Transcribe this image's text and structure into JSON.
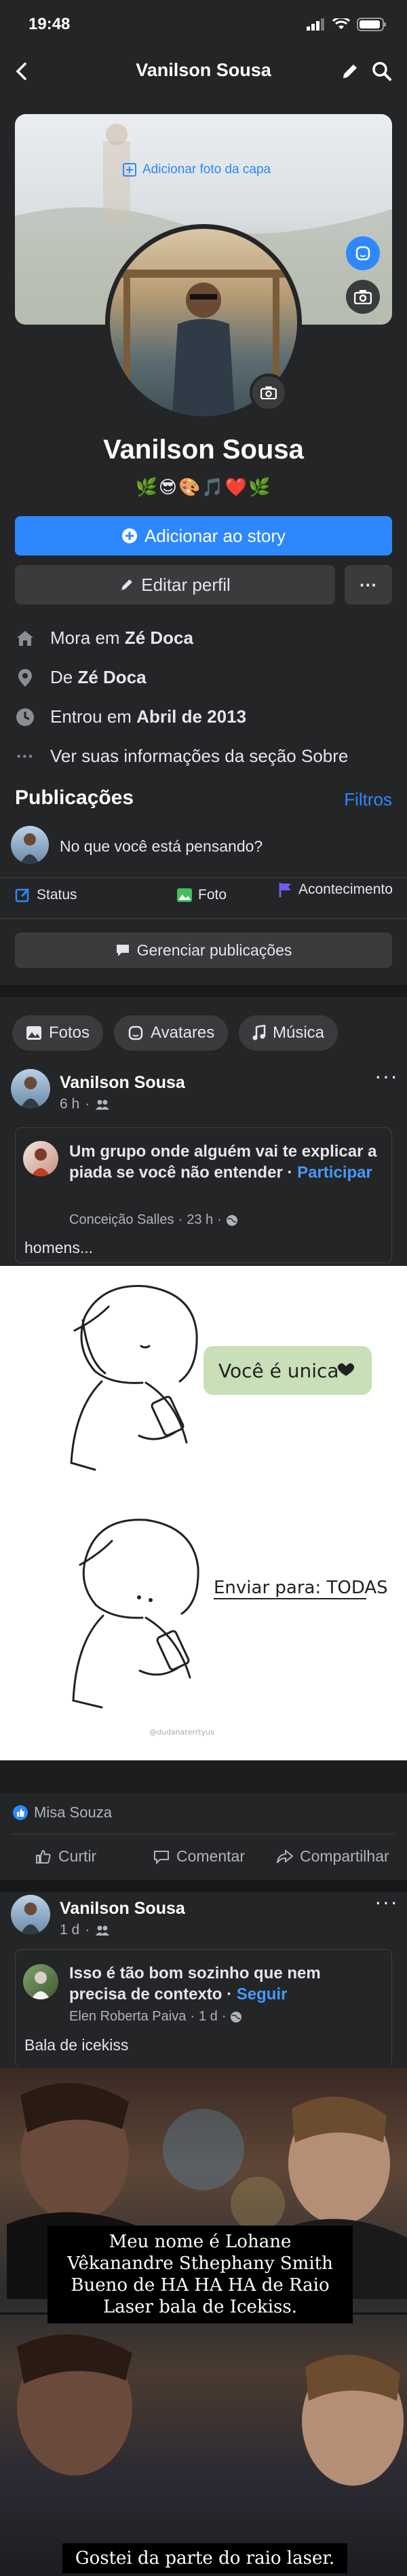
{
  "status_bar": {
    "time": "19:48"
  },
  "nav": {
    "title": "Vanilson Sousa"
  },
  "cover": {
    "add_cover_label": "Adicionar foto da capa"
  },
  "profile": {
    "name": "Vanilson Sousa",
    "bio_emojis": "🌿😎🎨🎵❤️🌿"
  },
  "actions": {
    "add_story": "Adicionar ao story",
    "edit_profile": "Editar perfil",
    "more": "···"
  },
  "intro": [
    {
      "icon": "home-icon",
      "text_prefix": "Mora em ",
      "text_bold": "Zé Doca"
    },
    {
      "icon": "location-pin-icon",
      "text_prefix": "De ",
      "text_bold": "Zé Doca"
    },
    {
      "icon": "clock-icon",
      "text_prefix": "Entrou em ",
      "text_bold": "Abril de 2013"
    },
    {
      "icon": "more-dots-icon",
      "text_prefix": "Ver suas informações da seção Sobre",
      "text_bold": ""
    }
  ],
  "publications": {
    "title": "Publicações",
    "filters": "Filtros",
    "composer_placeholder": "No que você está pensando?",
    "tabs": [
      "Status",
      "Foto",
      "Acontecimento"
    ],
    "manage": "Gerenciar publicações"
  },
  "chips": [
    "Fotos",
    "Avatares",
    "Música"
  ],
  "posts": [
    {
      "author": "Vanilson Sousa",
      "time": "6 h",
      "shared_title": "Um grupo onde alguém vai te explicar a piada se você não entender · ",
      "shared_link": "Participar",
      "shared_author": "Conceição Salles",
      "shared_time": "23 h",
      "caption": "homens...",
      "comic_text_1": "Você é unica",
      "comic_text_2": "Enviar para: TODAS",
      "comic_watermark": "@dudanaterrtyus",
      "reaction_name": "Misa Souza",
      "like": "Curtir",
      "comment": "Comentar",
      "share": "Compartilhar"
    },
    {
      "author": "Vanilson Sousa",
      "time": "1 d",
      "shared_title": "Isso é tão bom sozinho que nem precisa de contexto · ",
      "shared_link": "Seguir",
      "shared_author": "Elen Roberta Paiva",
      "shared_time": "1 d",
      "caption": "Bala de icekiss",
      "meme_caption_1": "Meu nome é Lohane Vêkanandre Sthephany Smith Bueno de HA HA HA de Raio Laser bala de Icekiss.",
      "meme_caption_2": "Gostei da parte do raio laser."
    }
  ],
  "colors": {
    "accent": "#2d88ff",
    "background": "#242526",
    "separator": "#18191a"
  }
}
